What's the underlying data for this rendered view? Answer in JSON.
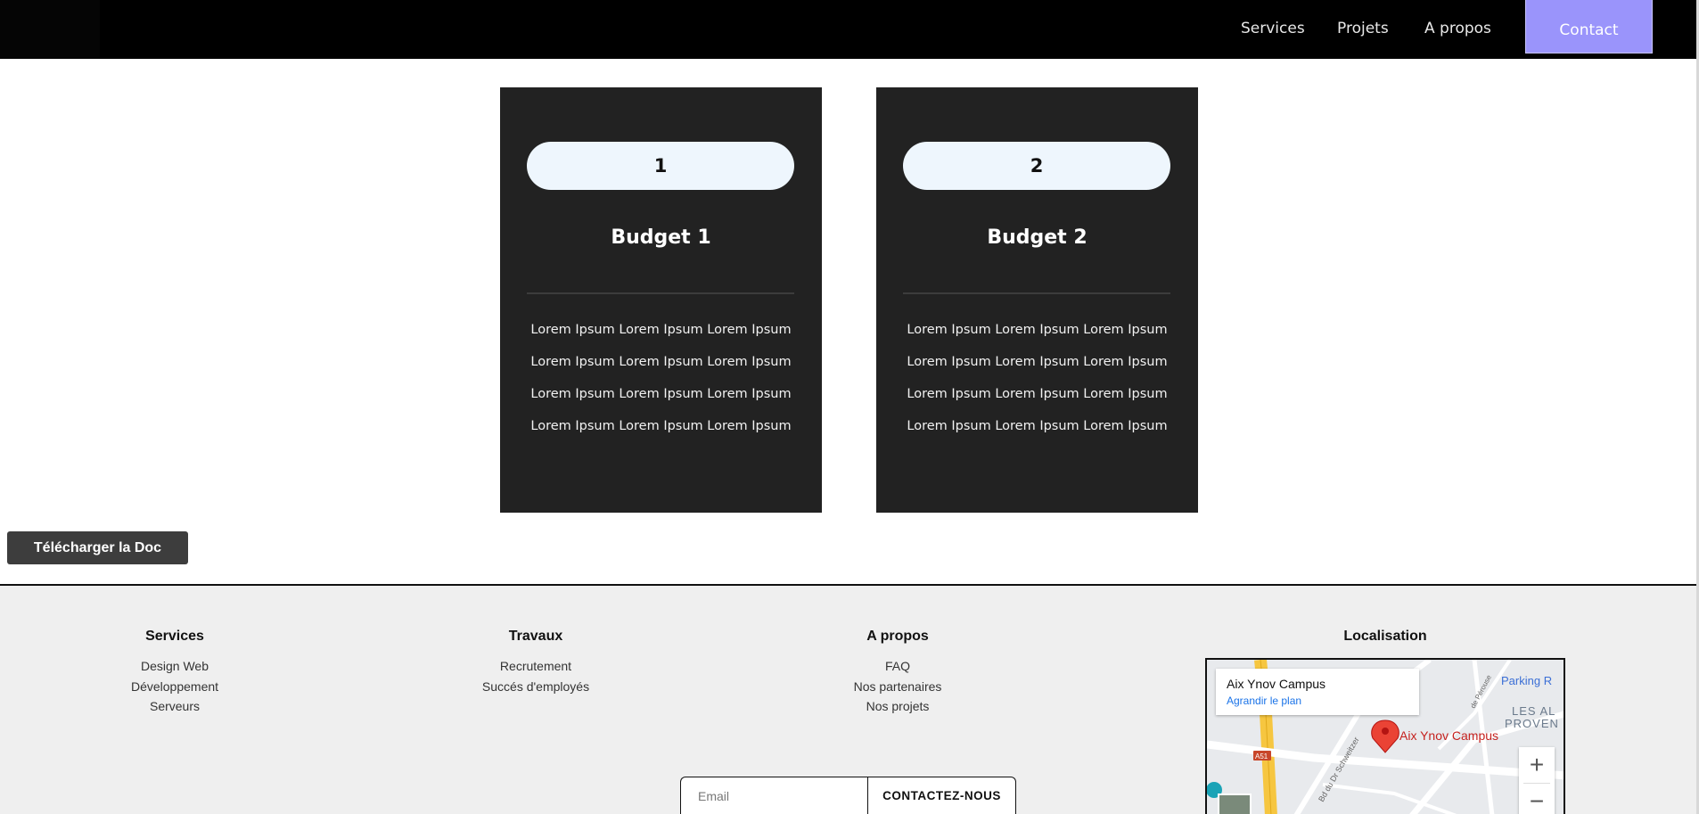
{
  "header": {
    "nav": [
      "Services",
      "Projets",
      "A propos"
    ],
    "contact_label": "Contact"
  },
  "cards": [
    {
      "number": "1",
      "title": "Budget 1",
      "lines": [
        "Lorem Ipsum Lorem Ipsum Lorem Ipsum",
        "Lorem Ipsum Lorem Ipsum Lorem Ipsum",
        "Lorem Ipsum Lorem Ipsum Lorem Ipsum",
        "Lorem Ipsum Lorem Ipsum Lorem Ipsum"
      ]
    },
    {
      "number": "2",
      "title": "Budget 2",
      "lines": [
        "Lorem Ipsum Lorem Ipsum Lorem Ipsum",
        "Lorem Ipsum Lorem Ipsum Lorem Ipsum",
        "Lorem Ipsum Lorem Ipsum Lorem Ipsum",
        "Lorem Ipsum Lorem Ipsum Lorem Ipsum"
      ]
    }
  ],
  "download_label": "Télécharger la Doc",
  "footer": {
    "columns": [
      {
        "heading": "Services",
        "links": [
          "Design Web",
          "Développement",
          "Serveurs"
        ]
      },
      {
        "heading": "Travaux",
        "links": [
          "Recrutement",
          "Succés d'employés"
        ]
      },
      {
        "heading": "A propos",
        "links": [
          "FAQ",
          "Nos partenaires",
          "Nos projets"
        ]
      }
    ],
    "location_heading": "Localisation",
    "map": {
      "place_name": "Aix Ynov Campus",
      "enlarge_label": "Agrandir le plan",
      "pin_label": "Aix Ynov Campus",
      "labels": [
        "Parking R",
        "LES AL",
        "PROVEN",
        "A51",
        "Bd du Dr Schweitzer",
        "de Pérouse"
      ]
    },
    "email_placeholder": "Email",
    "submit_label": "CONTACTEZ-NOUS"
  },
  "colors": {
    "header_bg": "#000000",
    "contact_accent": "#9a94fb",
    "card_bg": "#222222",
    "badge_bg": "#eef6fd",
    "footer_bg": "#efefef"
  }
}
